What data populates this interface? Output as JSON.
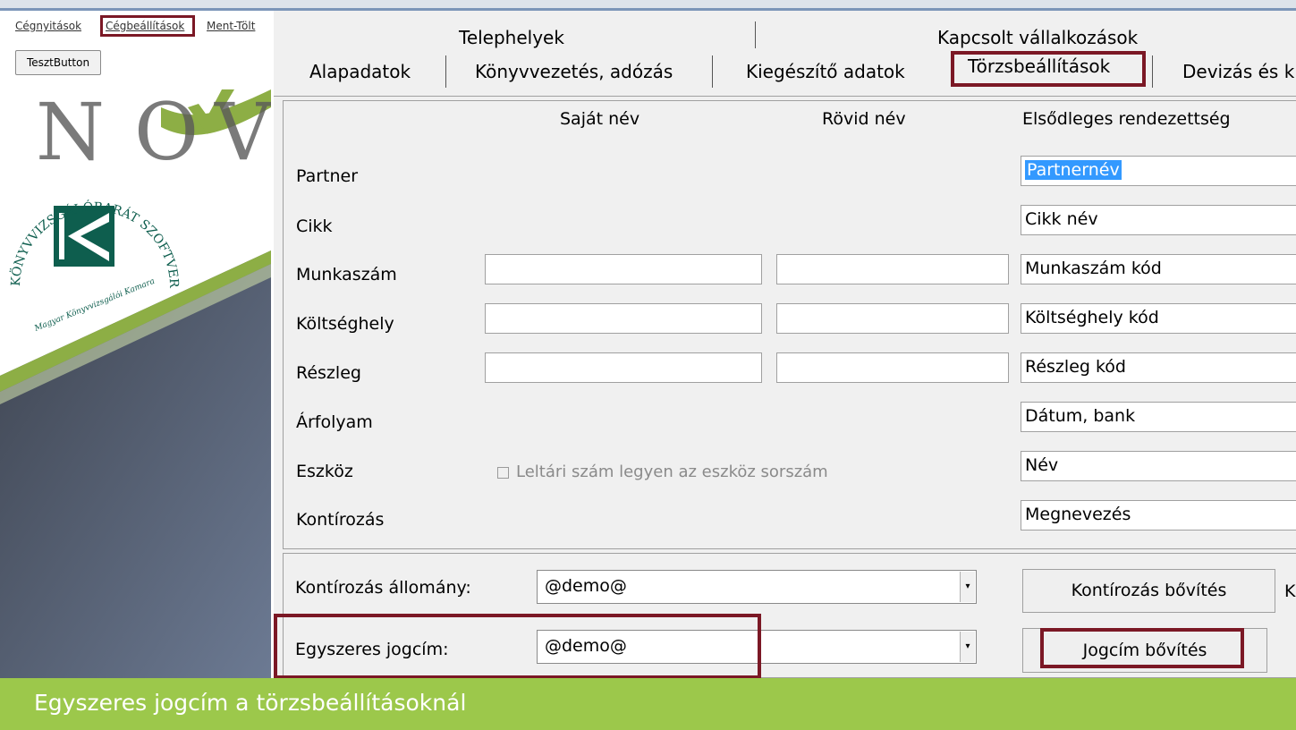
{
  "left_panel": {
    "menu": [
      {
        "label": "Cégnyitások"
      },
      {
        "label": "Cégbeállítások",
        "active": true
      },
      {
        "label": "Ment-Tölt"
      }
    ],
    "test_button": "TesztButton"
  },
  "tabs": {
    "row1": [
      "Telephelyek",
      "Kapcsolt vállalkozások"
    ],
    "row2": [
      "Alapadatok",
      "Könyvvezetés, adózás",
      "Kiegészítő adatok",
      "Törzsbeállítások",
      "Devizás és k"
    ],
    "active": "Törzsbeállítások"
  },
  "grid": {
    "headers": [
      "Saját név",
      "Rövid név",
      "Elsődleges rendezettség"
    ],
    "rows": [
      {
        "label": "Partner",
        "order": "Partnernév"
      },
      {
        "label": "Cikk",
        "order": "Cikk név"
      },
      {
        "label": "Munkaszám",
        "order": "Munkaszám kód"
      },
      {
        "label": "Költséghely",
        "order": "Költséghely kód"
      },
      {
        "label": "Részleg",
        "order": "Részleg kód"
      },
      {
        "label": "Árfolyam",
        "order": "Dátum, bank"
      },
      {
        "label": "Eszköz",
        "order": "Név"
      },
      {
        "label": "Kontírozás",
        "order": "Megnevezés"
      }
    ],
    "checkbox_label": "Leltári szám legyen az eszköz sorszám"
  },
  "bottom": {
    "kontirozas_label": "Kontírozás állomány:",
    "kontirozas_value": "@demo@",
    "kontirozas_button": "Kontírozás bővítés",
    "cut_label": "K",
    "jogcim_label": "Egyszeres jogcím:",
    "jogcim_value": "@demo@",
    "jogcim_button": "Jogcím bővítés",
    "dropdown_arrow": "▾"
  },
  "caption": "Egyszeres jogcím a törzsbeállításoknál",
  "colors": {
    "highlight_border": "#7b1825",
    "caption_bg": "#9cc84b",
    "selection": "#3399ff"
  }
}
